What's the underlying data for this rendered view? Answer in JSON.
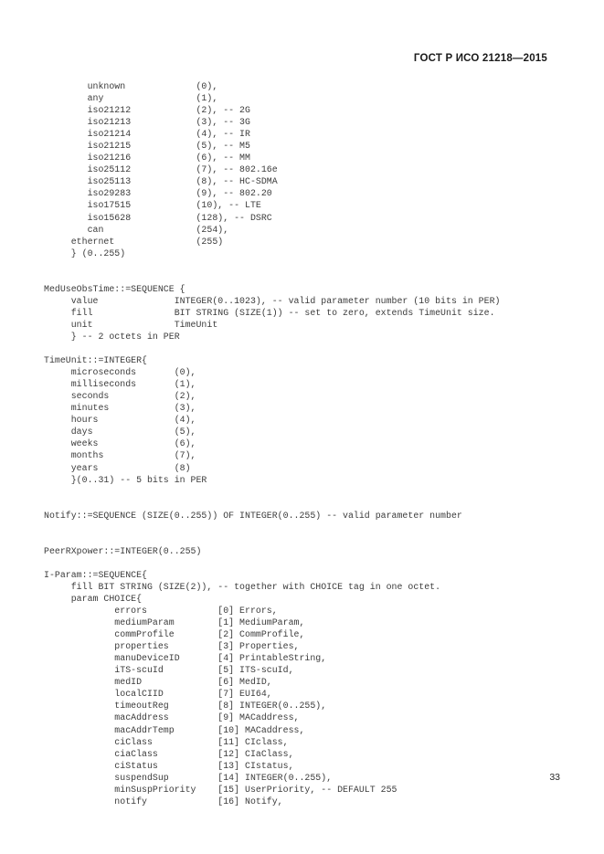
{
  "header": {
    "standard_title": "ГОСТ Р ИСО 21218—2015"
  },
  "footer": {
    "page_number": "33"
  },
  "code_listing": {
    "language": "ASN.1",
    "lines": [
      "        unknown             (0),",
      "        any                 (1),",
      "        iso21212            (2), -- 2G",
      "        iso21213            (3), -- 3G",
      "        iso21214            (4), -- IR",
      "        iso21215            (5), -- M5",
      "        iso21216            (6), -- MM",
      "        iso25112            (7), -- 802.16e",
      "        iso25113            (8), -- HC-SDMA",
      "        iso29283            (9), -- 802.20",
      "        iso17515            (10), -- LTE",
      "        iso15628            (128), -- DSRC",
      "        can                 (254),",
      "     ethernet               (255)",
      "     } (0..255)",
      "",
      "",
      "MedUseObsTime::=SEQUENCE {",
      "     value              INTEGER(0..1023), -- valid parameter number (10 bits in PER)",
      "     fill               BIT STRING (SIZE(1)) -- set to zero, extends TimeUnit size.",
      "     unit               TimeUnit",
      "     } -- 2 octets in PER",
      "",
      "TimeUnit::=INTEGER{",
      "     microseconds       (0),",
      "     milliseconds       (1),",
      "     seconds            (2),",
      "     minutes            (3),",
      "     hours              (4),",
      "     days               (5),",
      "     weeks              (6),",
      "     months             (7),",
      "     years              (8)",
      "     }(0..31) -- 5 bits in PER",
      "",
      "",
      "Notify::=SEQUENCE (SIZE(0..255)) OF INTEGER(0..255) -- valid parameter number",
      "",
      "",
      "PeerRXpower::=INTEGER(0..255)",
      "",
      "I-Param::=SEQUENCE{",
      "     fill BIT STRING (SIZE(2)), -- together with CHOICE tag in one octet.",
      "     param CHOICE{",
      "             errors             [0] Errors,",
      "             mediumParam        [1] MediumParam,",
      "             commProfile        [2] CommProfile,",
      "             properties         [3] Properties,",
      "             manuDeviceID       [4] PrintableString,",
      "             iTS-scuId          [5] ITS-scuId,",
      "             medID              [6] MedID,",
      "             localCIID          [7] EUI64,",
      "             timeoutReg         [8] INTEGER(0..255),",
      "             macAddress         [9] MACaddress,",
      "             macAddrTemp        [10] MACaddress,",
      "             ciClass            [11] CIclass,",
      "             ciaClass           [12] CIaClass,",
      "             ciStatus           [13] CIstatus,",
      "             suspendSup         [14] INTEGER(0..255),",
      "             minSuspPriority    [15] UserPriority, -- DEFAULT 255",
      "             notify             [16] Notify,"
    ]
  }
}
